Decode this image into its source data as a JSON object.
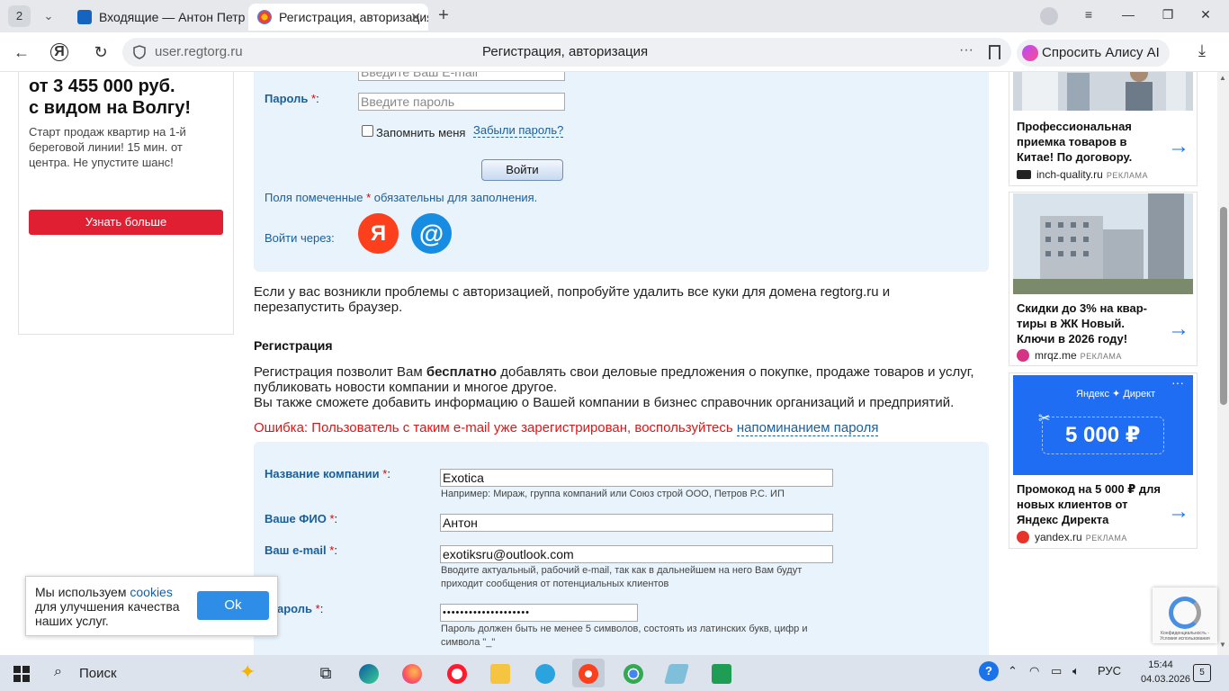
{
  "browser": {
    "tab_count": "2",
    "tabs": [
      {
        "title": "Входящие — Антон Петров",
        "active": false
      },
      {
        "title": "Регистрация, авторизация",
        "active": true
      }
    ],
    "url": "user.regtorg.ru",
    "page_title": "Регистрация, авторизация",
    "alice_label": "Спросить Алису AI"
  },
  "left_ad": {
    "price": "от 3 455 000 руб.",
    "headline": "с видом на Волгу!",
    "desc": "Старт продаж квартир на 1-й береговой линии! 15 мин. от центра. Не упустите шанс!",
    "button": "Узнать больше"
  },
  "login": {
    "email_placeholder": "Введите Ваш E-mail",
    "password_label": "Пароль",
    "password_placeholder": "Введите пароль",
    "remember": "Запомнить меня",
    "forgot": "Забыли пароль?",
    "submit": "Войти",
    "required_note_a": "Поля помеченные",
    "required_note_b": "обязательны для заполнения.",
    "login_via": "Войти через:"
  },
  "cookie_tip": "Если у вас возникли проблемы с авторизацией, попробуйте удалить все куки для домена regtorg.ru и перезапустить браузер.",
  "registration": {
    "title": "Регистрация",
    "intro_a": "Регистрация позволит Вам",
    "intro_bold": "бесплатно",
    "intro_b": "добавлять свои деловые предложения о покупке, продаже товаров и услуг, публиковать новости компании и многое другое.",
    "intro_c": "Вы также сможете добавить информацию о Вашей компании в бизнес справочник организаций и предприятий.",
    "error": "Ошибка: Пользователь с таким e-mail уже зарегистрирован, воспользуйтесь",
    "error_link": "напоминанием пароля",
    "company_label": "Название компании",
    "company_value": "Exotica",
    "company_hint": "Например: Мираж, группа компаний или Союз строй ООО, Петров Р.С. ИП",
    "fio_label": "Ваше ФИО",
    "fio_value": "Антон",
    "email_label": "Ваш e-mail",
    "email_value": "exotiksru@outlook.com",
    "email_hint_1": "Вводите актуальный, рабочий e-mail, так как в дальнейшем на него Вам будут",
    "email_hint_2": "приходит сообщения от потенциальных клиентов",
    "password_label": "ароль",
    "password_value": "••••••••••••••••••••",
    "password_hint_1": "Пароль должен быть не менее 5 символов, состоять из латинских букв, цифр и",
    "password_hint_2": "символа \"_\""
  },
  "right_ads": [
    {
      "title": "Профессиональная приемка товаров в Китае! По договору.",
      "domain": "inch-quality.ru",
      "ad_label": "РЕКЛАМА",
      "color": "#222222"
    },
    {
      "title": "Скидки до 3% на квар-тиры в ЖК Новый. Ключи в 2026 году!",
      "domain": "mrqz.me",
      "ad_label": "РЕКЛАМА",
      "color": "#d63384"
    },
    {
      "title": "Промокод на 5 000 ₽ для новых клиентов от Яндекс Директа",
      "domain": "yandex.ru",
      "ad_label": "РЕКЛАМА",
      "color": "#e8332a",
      "banner_brand": "Яндекс ✦ Директ",
      "banner_amount": "5 000 ₽"
    }
  ],
  "cookie_popup": {
    "text_a": "Мы используем",
    "link": "cookies",
    "text_b": "для улучшения качества наших услуг.",
    "ok": "Ok"
  },
  "recaptcha_text": "Конфиденциальность - Условия использования",
  "taskbar": {
    "search": "Поиск",
    "lang": "РУС",
    "time": "15:44",
    "date": "04.03.2026",
    "notifications": "5"
  },
  "colors": {
    "accent": "#1a5e9a",
    "panel": "#e8f3fb",
    "error": "#e01515",
    "ad_button": "#e01f32"
  }
}
